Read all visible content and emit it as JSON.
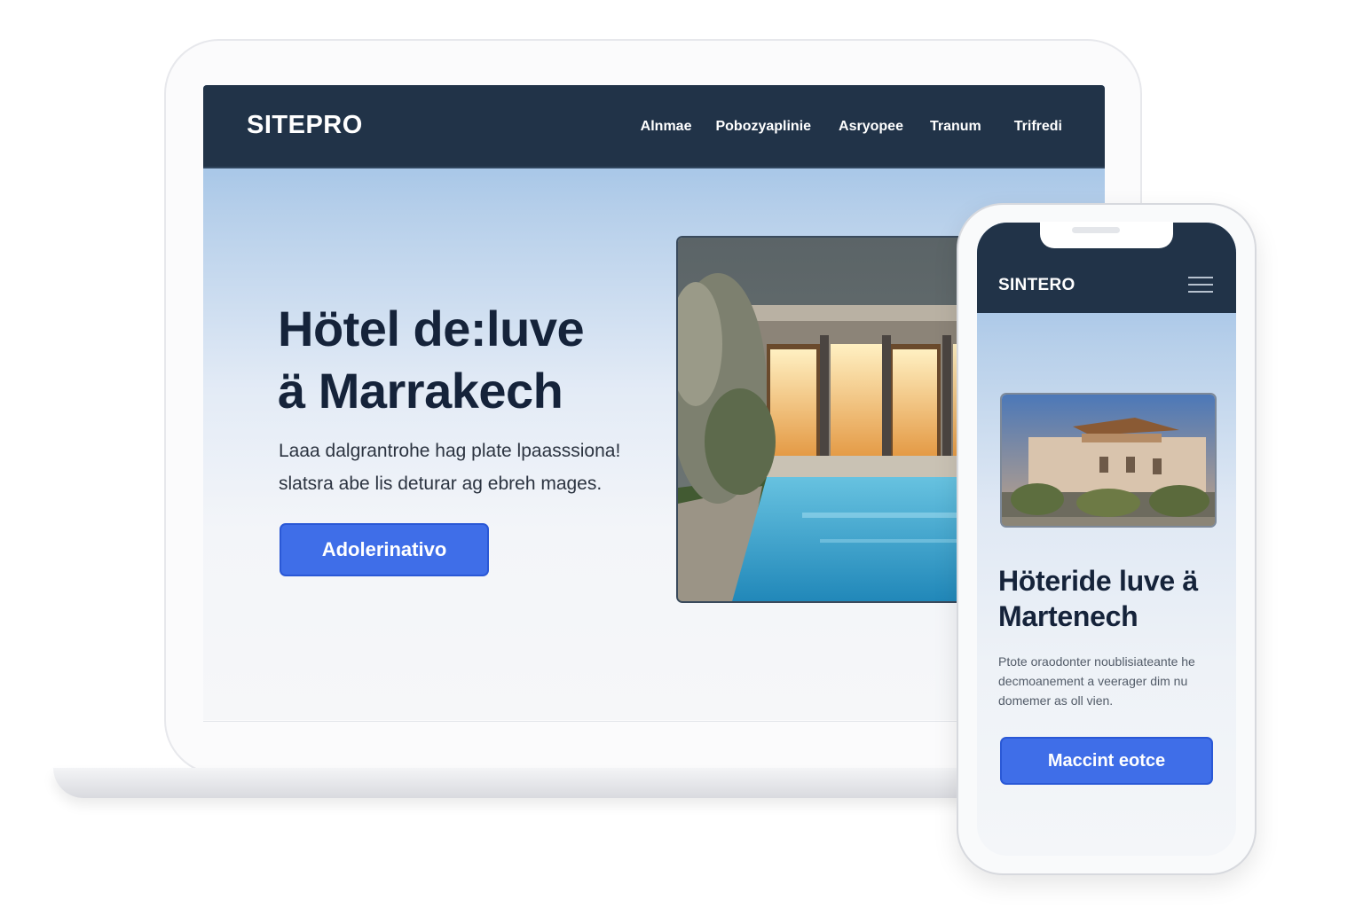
{
  "desktop": {
    "brand": "SITEPRO",
    "nav": [
      {
        "label": "Alnmae"
      },
      {
        "label": "Pobozyaplinie"
      },
      {
        "label": "Asryopee"
      },
      {
        "label": "Tranum"
      },
      {
        "label": "Trifredi"
      }
    ],
    "hero": {
      "title_line1": "Hötel de:luve",
      "title_line2": "ä Marrakech",
      "subtitle_line1": "Laaa dalgrantrohe hag plate lpaasssiona!",
      "subtitle_line2": "slatsra abe lis deturar ag ebreh mages.",
      "cta_label": "Adolerinativo"
    }
  },
  "mobile": {
    "brand": "SINTERO",
    "menu_icon": "hamburger-menu-icon",
    "hero": {
      "title": "Höteride luve ä Martenech",
      "subtitle": "Ptote oraodonter noublisiateante he decmoanement a veerager dim nu domemer as oll vien.",
      "cta_label": "Maccint eotce"
    }
  },
  "colors": {
    "nav_background": "#213348",
    "accent": "#3f6ee8",
    "heading": "#15233a"
  }
}
